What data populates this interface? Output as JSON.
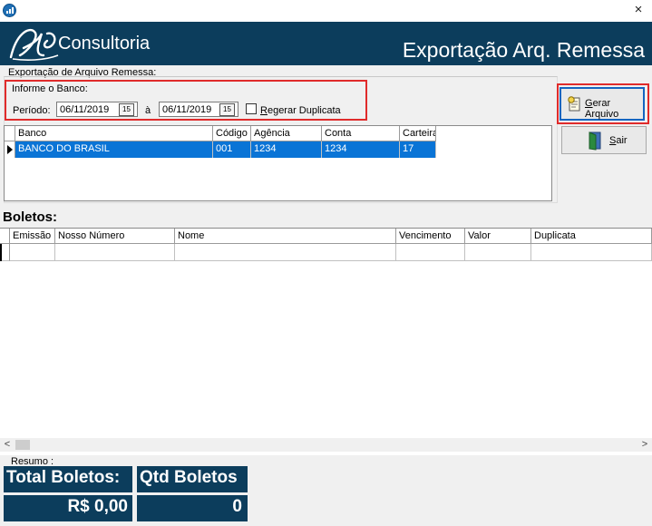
{
  "window": {
    "close_glyph": "×"
  },
  "banner": {
    "brand": "Consultoria",
    "screen_title": "Exportação Arq. Remessa"
  },
  "form": {
    "group_label": "Exportação de Arquivo Remessa:",
    "bank_group_label": "Informe o Banco:",
    "periodo_label": "Período:",
    "date_from": "06/11/2019",
    "date_to": "06/11/2019",
    "date_sep": "à",
    "calendar_glyph": "15",
    "regerar_label": "Regerar Duplicata",
    "regerar_checked": false
  },
  "bank_grid": {
    "columns": [
      "Banco",
      "Código",
      "Agência",
      "Conta",
      "Carteira"
    ],
    "rows": [
      {
        "banco": "BANCO DO BRASIL",
        "codigo": "001",
        "agencia": "1234",
        "conta": "1234",
        "carteira": "17"
      }
    ]
  },
  "buttons": {
    "gerar": "Gerar Arquivo",
    "sair": "Sair"
  },
  "boletos": {
    "title": "Boletos:",
    "columns": [
      "Emissão",
      "Nosso Número",
      "Nome",
      "Vencimento",
      "Valor",
      "Duplicata"
    ]
  },
  "resumo": {
    "label": "Resumo :",
    "total_label": "Total Boletos:",
    "total_value": "R$ 0,00",
    "qtd_label": "Qtd Boletos",
    "qtd_value": "0"
  },
  "scroll": {
    "left": "<",
    "right": ">"
  },
  "colors": {
    "banner": "#0c3d5c",
    "selection": "#0a74d6",
    "highlight": "#e02b2b"
  },
  "icons": [
    "app-icon",
    "close-icon",
    "logo",
    "calendar-icon",
    "gerar-arquivo-icon",
    "door-exit-icon"
  ]
}
